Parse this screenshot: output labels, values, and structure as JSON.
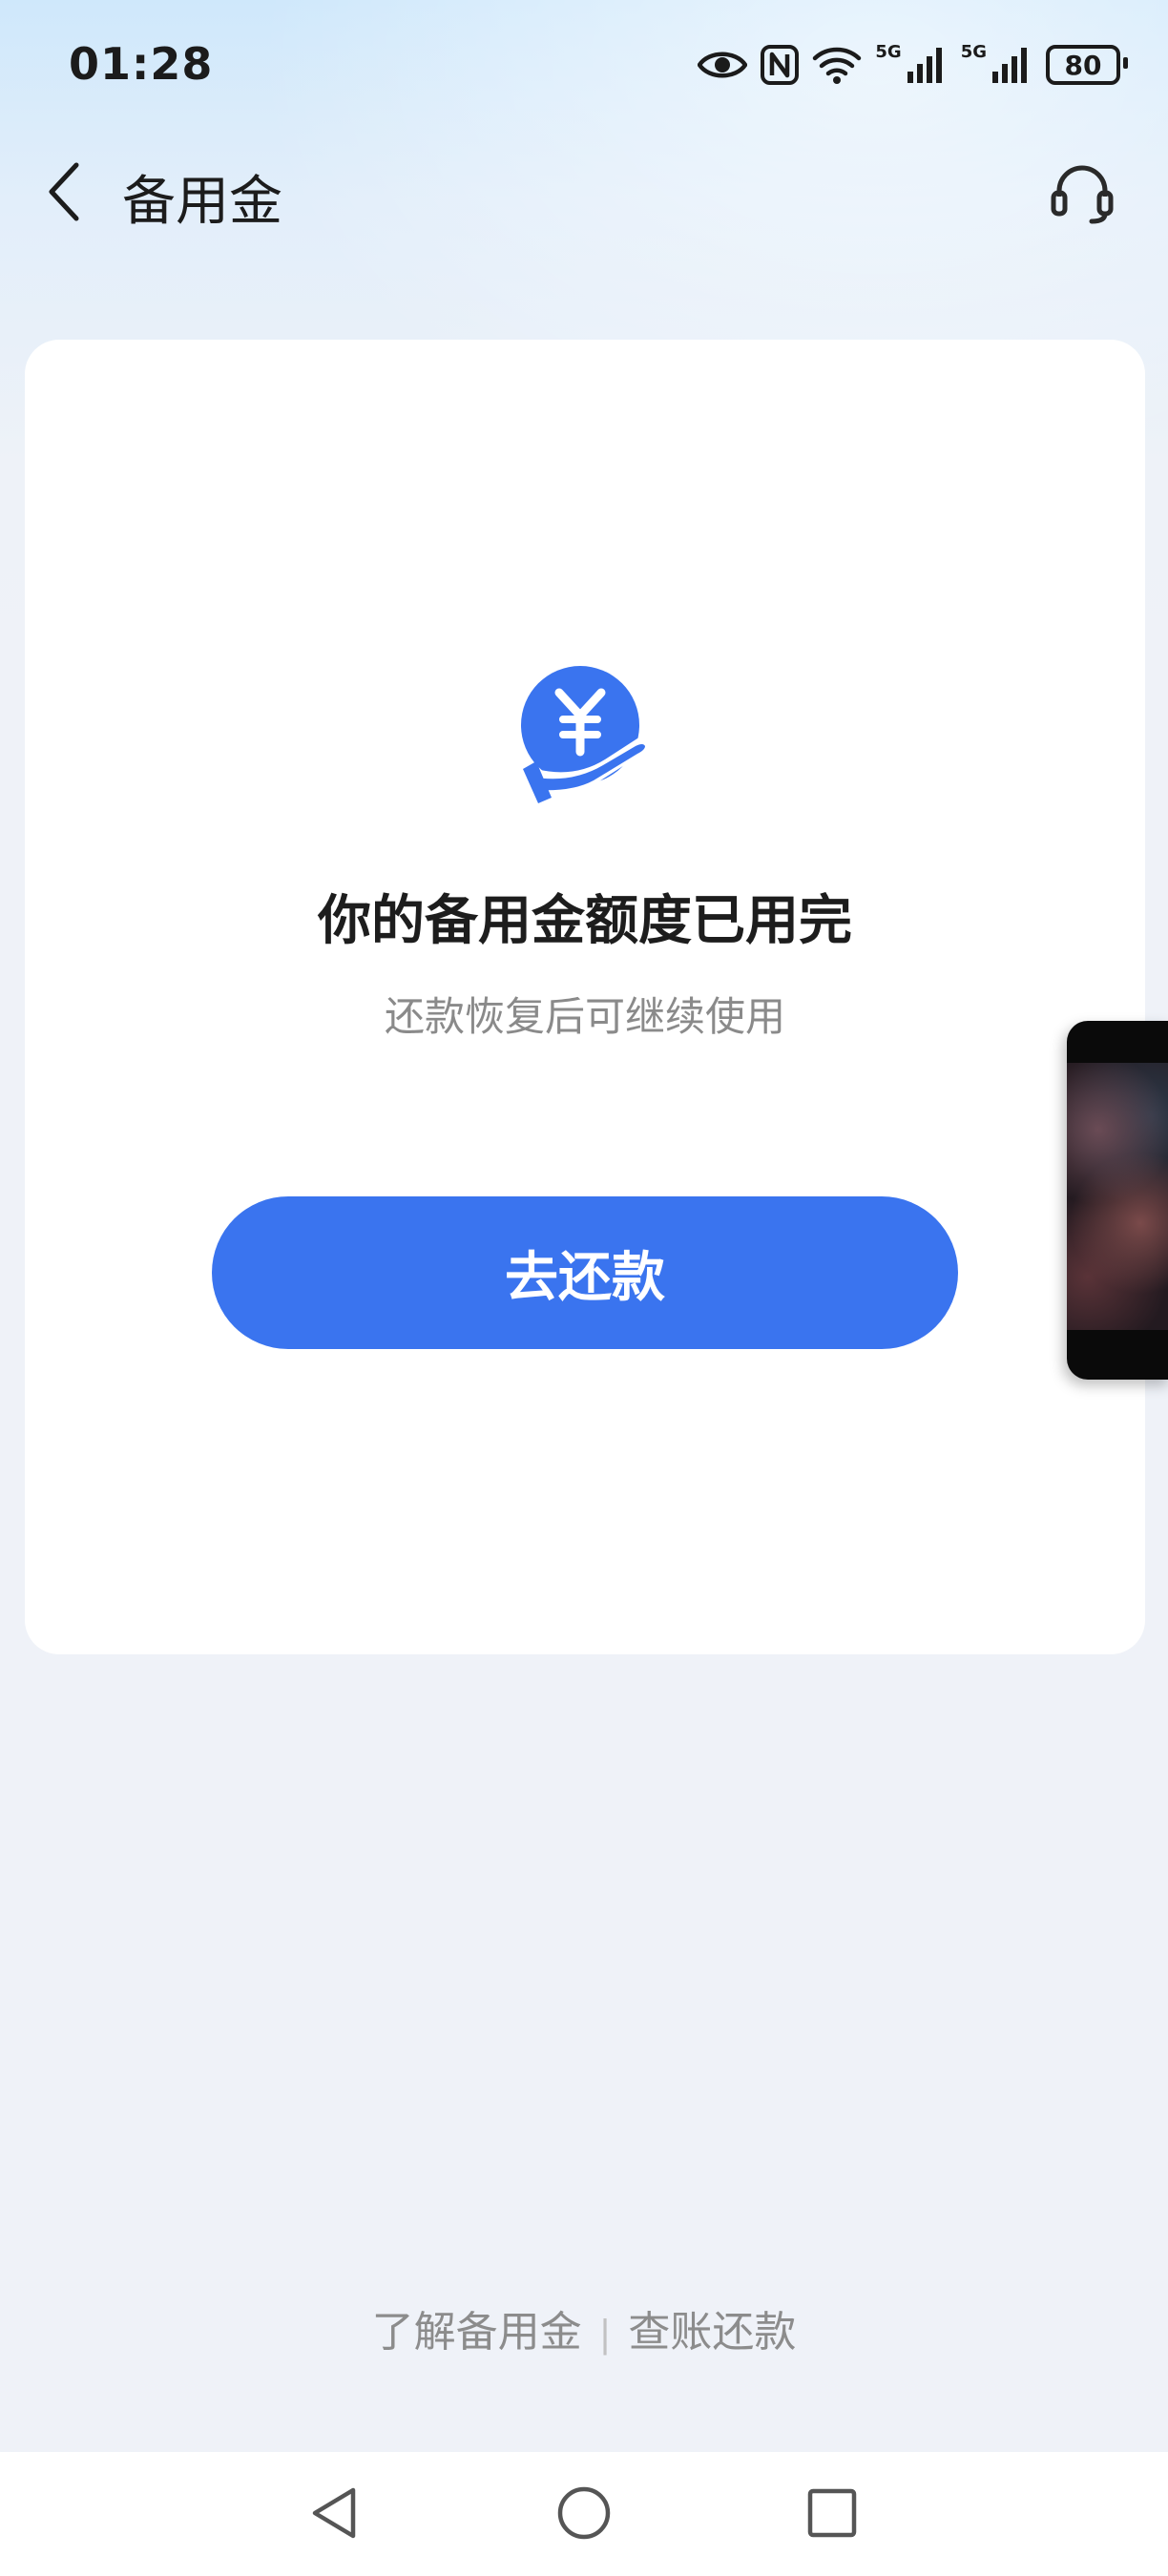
{
  "status_bar": {
    "time": "01:28",
    "signal_1_label": "5G",
    "signal_2_label": "5G",
    "battery_level": "80",
    "icons": [
      "eye-icon",
      "nfc-icon",
      "wifi-icon",
      "signal-icon",
      "signal-icon",
      "battery-icon"
    ]
  },
  "header": {
    "back_icon": "chevron-left-icon",
    "title": "备用金",
    "service_icon": "headset-icon"
  },
  "card": {
    "icon": "yuan-hand-icon",
    "title": "你的备用金额度已用完",
    "subtitle": "还款恢复后可继续使用",
    "button_label": "去还款",
    "colors": {
      "accent": "#3a74ef"
    }
  },
  "footer": {
    "link_1": "了解备用金",
    "separator": "|",
    "link_2": "查账还款"
  },
  "system_nav": {
    "icons": [
      "back-triangle-icon",
      "home-circle-icon",
      "recents-square-icon"
    ]
  }
}
